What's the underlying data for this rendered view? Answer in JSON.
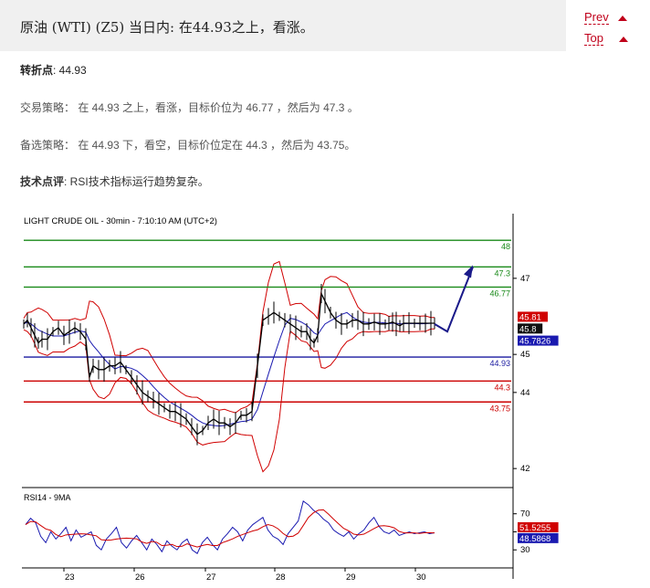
{
  "header": {
    "title": "原油 (WTI) (Z5) 当日内: 在44.93之上，看涨。"
  },
  "nav": {
    "prev": "Prev",
    "top": "Top"
  },
  "pivot": {
    "label": "转折点",
    "value": ": 44.93"
  },
  "strategy": {
    "text": "交易策略： 在 44.93 之上，看涨，目标价位为 46.77 ，然后为 47.3 。"
  },
  "alternative": {
    "text": "备选策略： 在 44.93 下，看空，目标价位定在 44.3 ，然后为 43.75。"
  },
  "comment": {
    "label": "技术点评",
    "text": ": RSI技术指标运行趋势复杂。"
  },
  "chart_data": {
    "type": "line",
    "title": "LIGHT CRUDE OIL - 30min - 7:10:10 AM (UTC+2)",
    "ylim": [
      41.5,
      48.7
    ],
    "y_ticks": [
      42,
      44,
      45,
      47
    ],
    "x_ticks": [
      "23",
      "26",
      "27",
      "28",
      "29",
      "30"
    ],
    "levels": [
      {
        "value": 48,
        "label": "48",
        "color": "#1a8a1a"
      },
      {
        "value": 47.3,
        "label": "47.3",
        "color": "#1a8a1a"
      },
      {
        "value": 46.77,
        "label": "46.77",
        "color": "#1a8a1a"
      },
      {
        "value": 44.93,
        "label": "44.93",
        "color": "#1a1aa0"
      },
      {
        "value": 44.3,
        "label": "44.3",
        "color": "#cc0000"
      },
      {
        "value": 43.75,
        "label": "43.75",
        "color": "#cc0000"
      }
    ],
    "price_series": {
      "x": [
        0,
        4,
        8,
        12,
        16,
        20,
        26,
        32,
        38,
        44,
        50,
        56,
        62,
        68,
        72,
        76,
        82,
        88,
        94,
        100,
        106,
        112,
        118,
        124,
        130,
        136,
        142,
        148,
        154,
        160,
        166,
        172,
        178,
        184,
        190,
        196,
        202,
        208,
        214,
        220,
        226,
        232,
        238,
        244,
        250,
        256,
        262,
        268,
        274,
        280,
        286,
        292,
        298,
        304,
        310,
        314,
        318,
        322,
        326,
        330,
        336,
        342,
        348,
        354,
        360,
        366,
        372,
        378,
        384,
        390,
        396,
        400,
        404,
        408,
        412,
        416,
        422,
        428,
        434,
        440,
        446,
        450
      ],
      "values": [
        45.8,
        45.9,
        45.7,
        45.5,
        45.3,
        45.4,
        45.4,
        45.6,
        45.7,
        45.5,
        45.6,
        45.7,
        45.6,
        45.4,
        44.4,
        44.7,
        44.6,
        44.6,
        44.7,
        44.7,
        44.8,
        44.6,
        44.4,
        44.2,
        44.0,
        43.9,
        43.8,
        43.7,
        43.6,
        43.5,
        43.5,
        43.4,
        43.3,
        43.1,
        42.9,
        43.0,
        43.2,
        43.3,
        43.2,
        43.2,
        43.1,
        43.2,
        43.4,
        43.4,
        43.5,
        44.7,
        45.9,
        46.0,
        46.1,
        46.0,
        45.9,
        45.8,
        45.7,
        45.6,
        45.6,
        45.4,
        45.3,
        45.5,
        46.6,
        46.4,
        46.1,
        45.9,
        45.8,
        45.8,
        45.9,
        45.9,
        45.8,
        45.8,
        45.85,
        45.8,
        45.8,
        45.82,
        45.85,
        45.8,
        45.75,
        45.82,
        45.82,
        45.82,
        45.82,
        45.82,
        45.82,
        45.82
      ]
    },
    "projection": {
      "values": [
        45.8,
        45.6,
        47.3
      ]
    },
    "price_labels": [
      {
        "value": 45.81,
        "label": "45.81",
        "color": "#d00000"
      },
      {
        "value": 45.8,
        "label": "45.8",
        "color": "#111111"
      },
      {
        "value": 45.7826,
        "label": "45.7826",
        "color": "#1a1ab0"
      }
    ],
    "rsi": {
      "title": "RSI14 - 9MA",
      "ylim": [
        10,
        95
      ],
      "y_ticks": [
        30,
        50,
        70
      ],
      "labels": [
        {
          "value": 51.5255,
          "label": "51.5255",
          "color": "#d00000"
        },
        {
          "value": 48.5868,
          "label": "48.5868",
          "color": "#1a1ab0"
        }
      ],
      "values": [
        58,
        65,
        60,
        45,
        38,
        50,
        42,
        48,
        55,
        40,
        52,
        44,
        47,
        50,
        35,
        30,
        42,
        48,
        55,
        38,
        32,
        40,
        46,
        38,
        30,
        42,
        36,
        28,
        40,
        34,
        30,
        38,
        42,
        30,
        26,
        38,
        44,
        36,
        30,
        42,
        48,
        55,
        50,
        40,
        52,
        58,
        62,
        66,
        52,
        45,
        42,
        36,
        48,
        55,
        62,
        84,
        80,
        74,
        70,
        64,
        60,
        52,
        48,
        45,
        50,
        42,
        48,
        52,
        60,
        66,
        56,
        50,
        48,
        52,
        46,
        48,
        50,
        48,
        49,
        50,
        48,
        49
      ]
    }
  }
}
